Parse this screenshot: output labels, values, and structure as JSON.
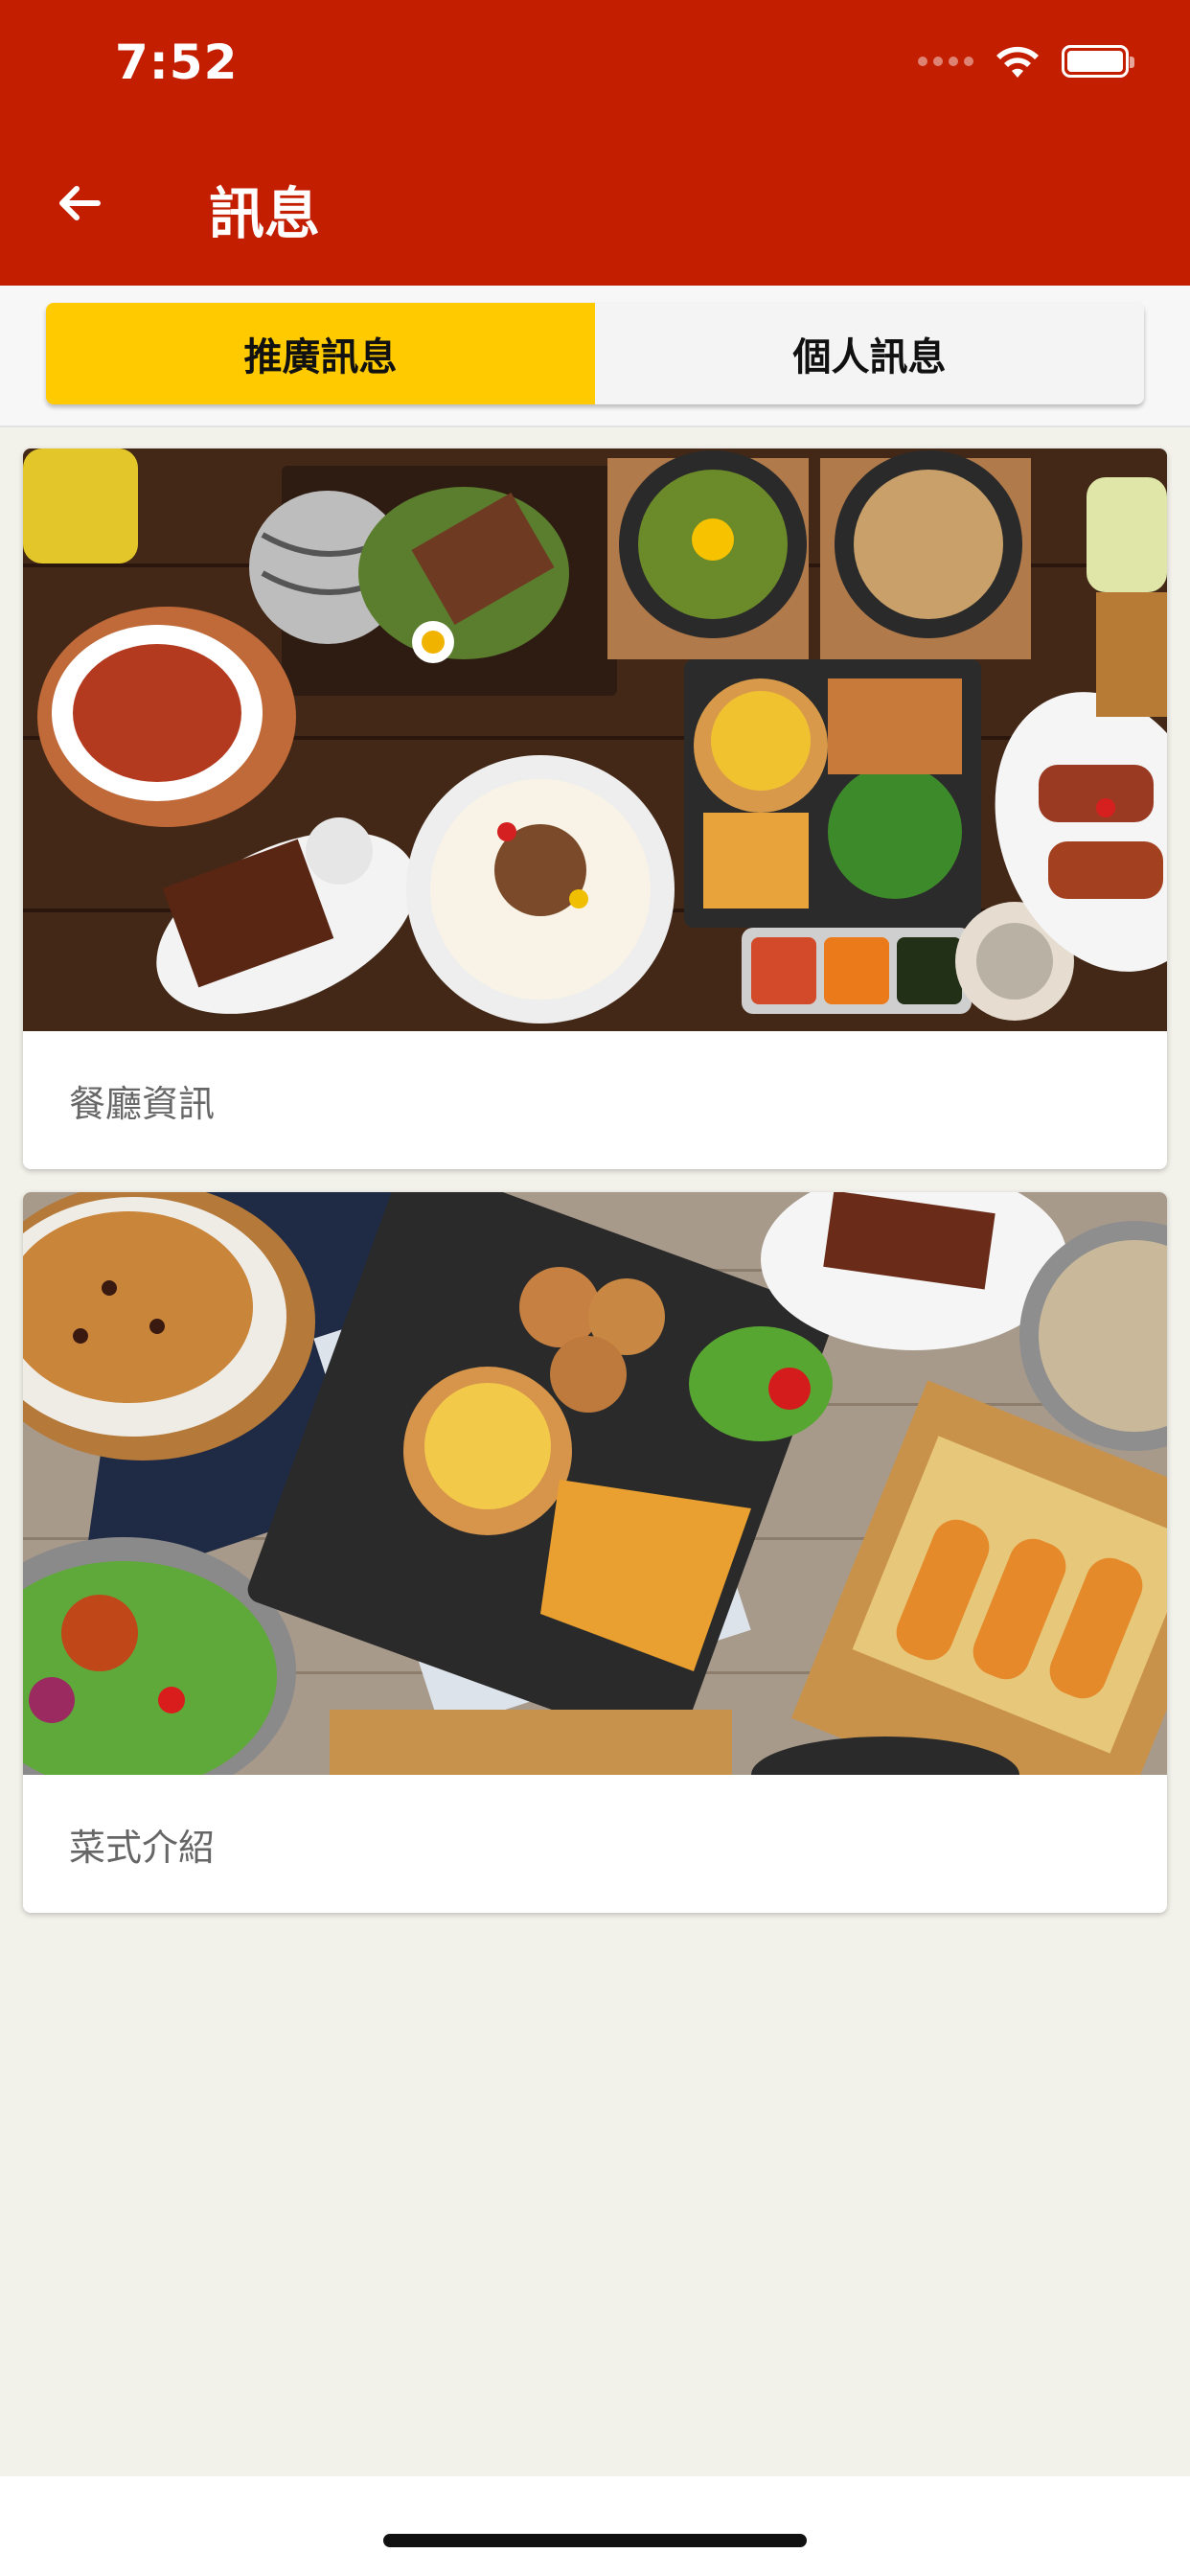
{
  "status_bar": {
    "time": "7:52"
  },
  "app_bar": {
    "title": "訊息",
    "back_icon": "arrow-left-icon"
  },
  "tabs": [
    {
      "label": "推廣訊息",
      "active": true
    },
    {
      "label": "個人訊息",
      "active": false
    }
  ],
  "cards": [
    {
      "caption": "餐廳資訊"
    },
    {
      "caption": "菜式介紹"
    }
  ],
  "colors": {
    "app_bar": "#c41e00",
    "active_tab": "#ffcb00",
    "background": "#f2f1ea"
  }
}
